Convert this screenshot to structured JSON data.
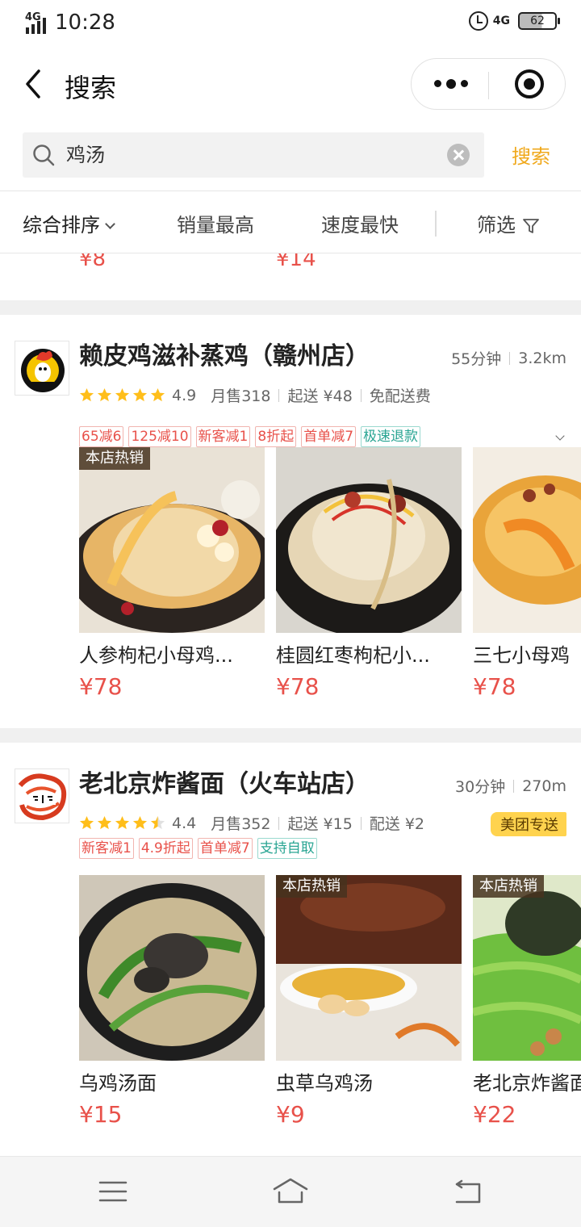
{
  "status_bar": {
    "network_left": "4G",
    "time": "10:28",
    "network_right": "4G",
    "battery": "62"
  },
  "nav": {
    "title": "搜索",
    "more_icon": "more-dots-icon",
    "capsule_target_icon": "target-icon"
  },
  "search": {
    "query": "鸡汤",
    "button_label": "搜索"
  },
  "sort_bar": {
    "items": [
      "综合排序",
      "销量最高",
      "速度最快"
    ],
    "filter_label": "筛选"
  },
  "partial_prices": [
    "¥8",
    "¥14"
  ],
  "shops": [
    {
      "name": "赖皮鸡滋补蒸鸡（赣州店）",
      "time": "55分钟",
      "distance": "3.2km",
      "rating": "4.9",
      "rating_value": 4.9,
      "monthly_sales": "月售318",
      "min_order": "起送 ¥48",
      "delivery_fee": "免配送费",
      "delivery_badge": "",
      "tags": [
        {
          "text": "65减6",
          "color": "red"
        },
        {
          "text": "125减10",
          "color": "red"
        },
        {
          "text": "新客减1",
          "color": "red"
        },
        {
          "text": "8折起",
          "color": "red"
        },
        {
          "text": "首单减7",
          "color": "red"
        },
        {
          "text": "极速退款",
          "color": "green"
        }
      ],
      "dishes": [
        {
          "name": "人参枸杞小母鸡...",
          "price": "¥78",
          "badge": "本店热销"
        },
        {
          "name": "桂圆红枣枸杞小...",
          "price": "¥78",
          "badge": ""
        },
        {
          "name": "三七小母鸡",
          "price": "¥78",
          "badge": ""
        }
      ]
    },
    {
      "name": "老北京炸酱面（火车站店）",
      "time": "30分钟",
      "distance": "270m",
      "rating": "4.4",
      "rating_value": 4.4,
      "monthly_sales": "月售352",
      "min_order": "起送 ¥15",
      "delivery_fee": "配送 ¥2",
      "delivery_badge": "美团专送",
      "tags": [
        {
          "text": "新客减1",
          "color": "red"
        },
        {
          "text": "4.9折起",
          "color": "red"
        },
        {
          "text": "首单减7",
          "color": "red"
        },
        {
          "text": "支持自取",
          "color": "green"
        }
      ],
      "dishes": [
        {
          "name": "乌鸡汤面",
          "price": "¥15",
          "badge": ""
        },
        {
          "name": "虫草乌鸡汤",
          "price": "¥9",
          "badge": "本店热销"
        },
        {
          "name": "老北京炸酱面",
          "price": "¥22",
          "badge": "本店热销"
        }
      ]
    }
  ],
  "colors": {
    "accent": "#f0a81b",
    "price": "#e8514a",
    "star": "#ffbe1a"
  }
}
